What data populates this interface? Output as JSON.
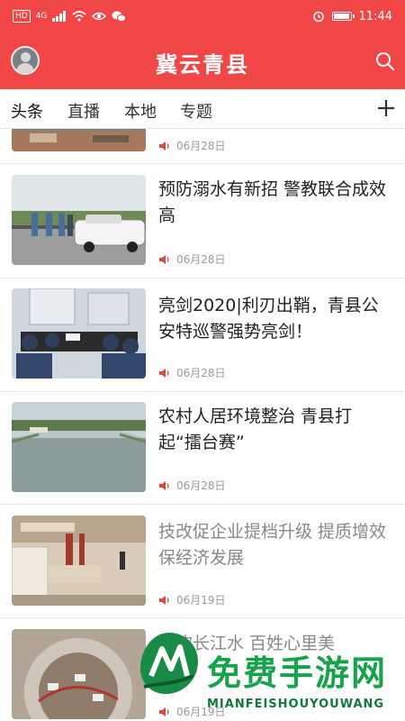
{
  "status_bar": {
    "carrier_badge": "HD",
    "network": "4G",
    "time": "11:44",
    "battery_level": 0.85,
    "icons": [
      "hd-icon",
      "signal-icon",
      "wifi-icon",
      "eye-icon",
      "wechat-icon",
      "alarm-icon",
      "battery-icon"
    ]
  },
  "header": {
    "title": "冀云青县",
    "avatar_icon": "user-avatar",
    "search_icon": "search-icon",
    "accent": "#f04646"
  },
  "tabs": {
    "items": [
      "头条",
      "直播",
      "本地",
      "专题"
    ],
    "active": "头条",
    "add_icon": "plus-icon"
  },
  "news": {
    "items": [
      {
        "title": "",
        "date": "06月28日",
        "thumb": "partial-photo"
      },
      {
        "title": "预防溺水有新招 警教联合成效高",
        "date": "06月28日",
        "thumb": "police-car-scene"
      },
      {
        "title": "亮剑2020|利刃出鞘，青县公安特巡警强势亮剑！",
        "date": "06月28日",
        "thumb": "meeting-room-scene"
      },
      {
        "title": "农村人居环境整治 青县打起“擂台赛”",
        "date": "06月28日",
        "thumb": "river-scene"
      },
      {
        "title": "技改促企业提档升级 提质增效保经济发展",
        "date": "06月19日",
        "thumb": "factory-scene"
      },
      {
        "title": "共饮长江水 百姓心里美",
        "date": "06月19日",
        "thumb": "water-tank-scene"
      }
    ],
    "audio_icon": "speaker-icon"
  },
  "watermark": {
    "text": "免费手游网",
    "sub": "MIANFEISHOUYOUWANG"
  }
}
